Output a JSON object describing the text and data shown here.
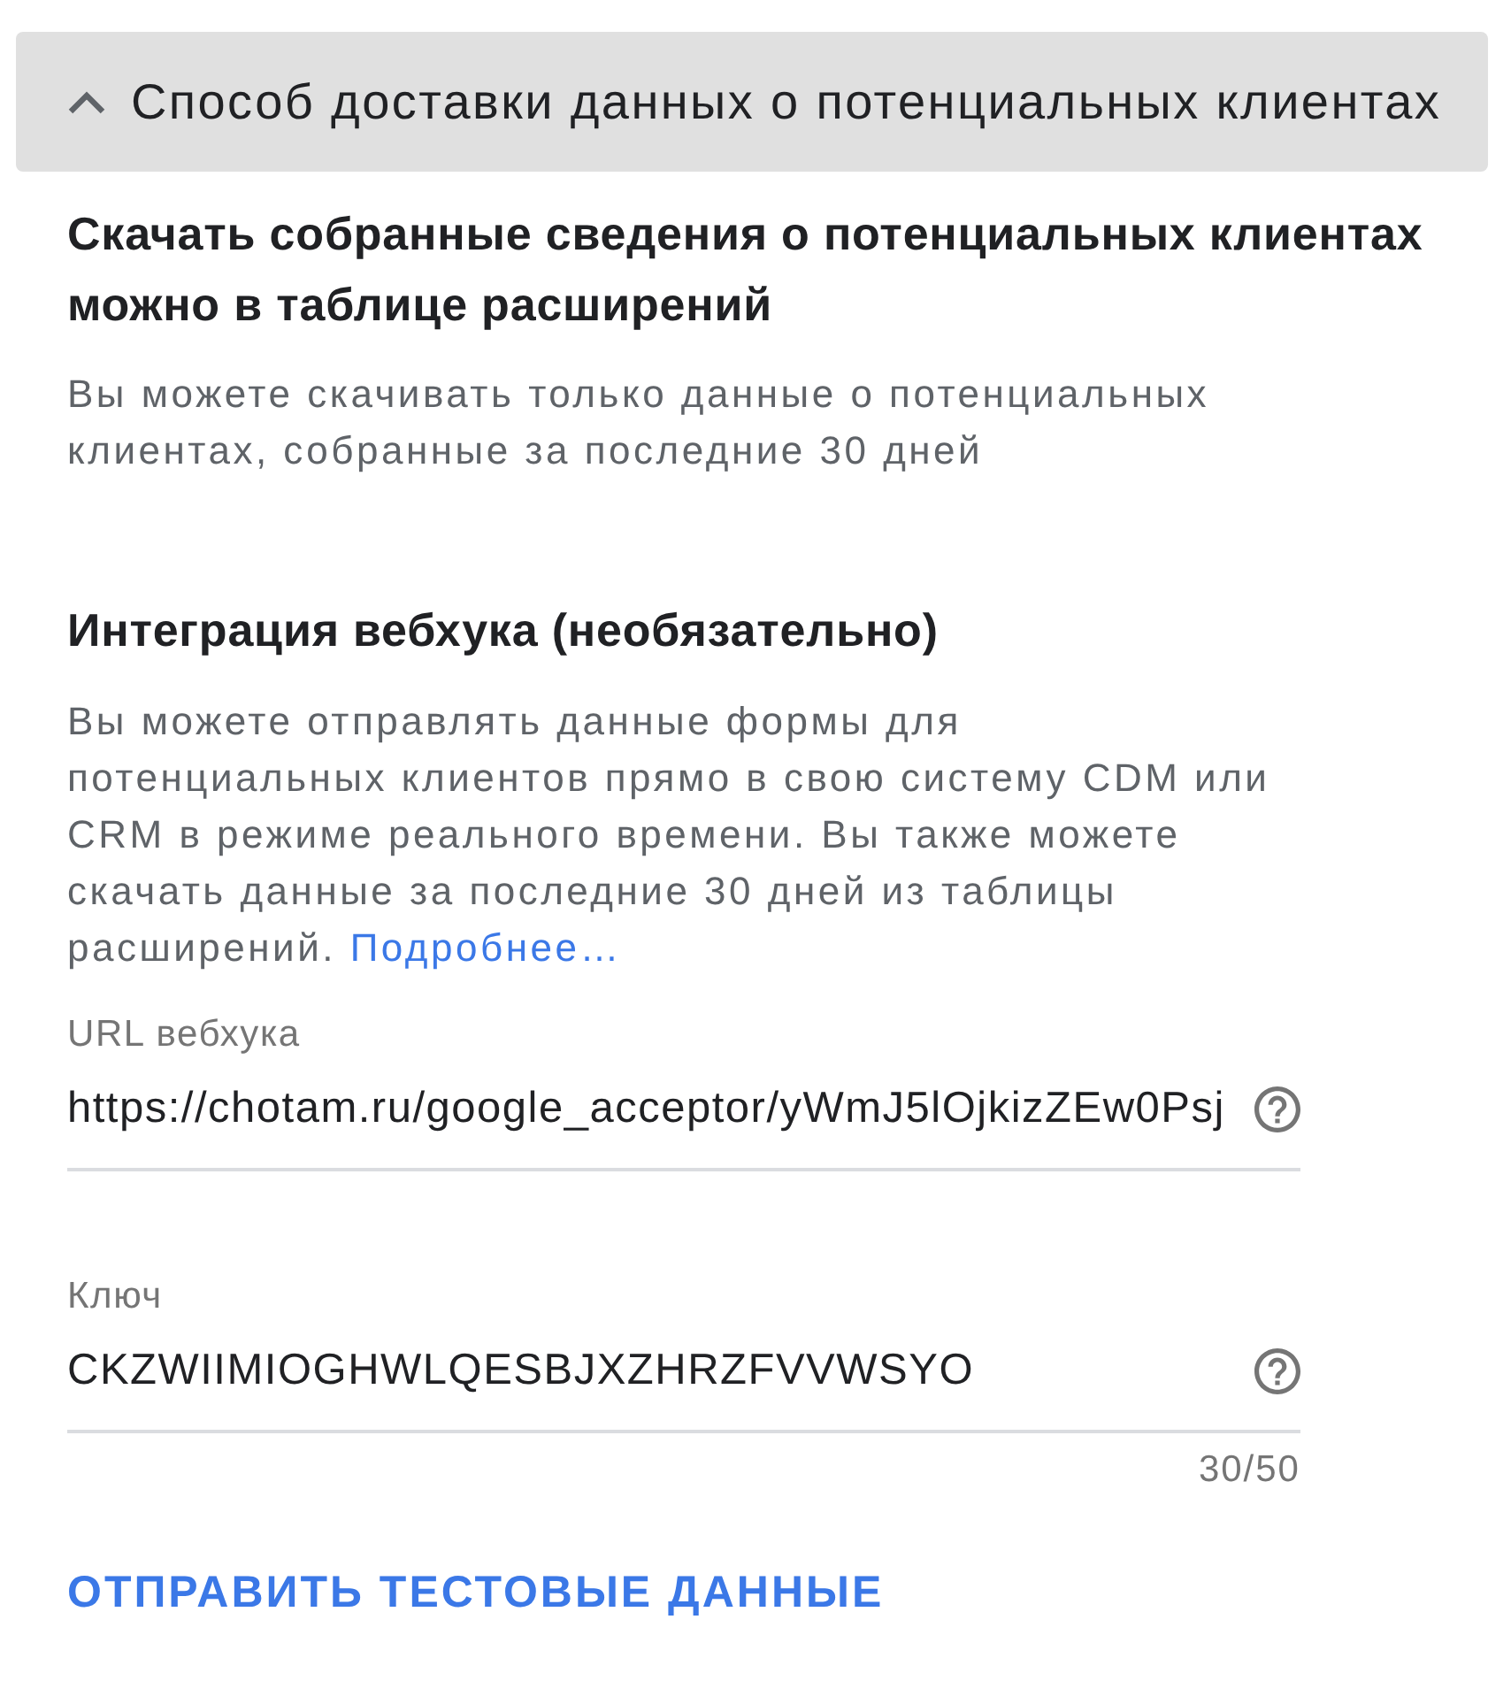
{
  "section": {
    "title": "Способ доставки данных о потенциальных клиентах",
    "expanded": true
  },
  "download": {
    "heading": "Скачать собранные сведения о потенциальных клиентах можно в таблице расширений",
    "description": "Вы можете скачивать только данные о потенциальных клиентах, собранные за последние 30 дней"
  },
  "webhook": {
    "heading": "Интеграция вебхука (необязательно)",
    "description": "Вы можете отправлять данные формы для потенциальных клиентов прямо в свою систему CDM или CRM в режиме реального времени. Вы также можете скачать данные за последние 30 дней из таблицы расширений.",
    "link": "Подробнее…",
    "fields": [
      {
        "label": "URL вебхука",
        "value": "https://chotam.ru/google_acceptor/yWmJ5lOjkizZEw0Psj"
      },
      {
        "label": "Ключ",
        "value": "CKZWIIMIOGHWLQESBJXZHRZFVVWSYO",
        "counter": "30/50"
      }
    ]
  },
  "test_button": "ОТПРАВИТЬ ТЕСТОВЫЕ ДАННЫЕ"
}
